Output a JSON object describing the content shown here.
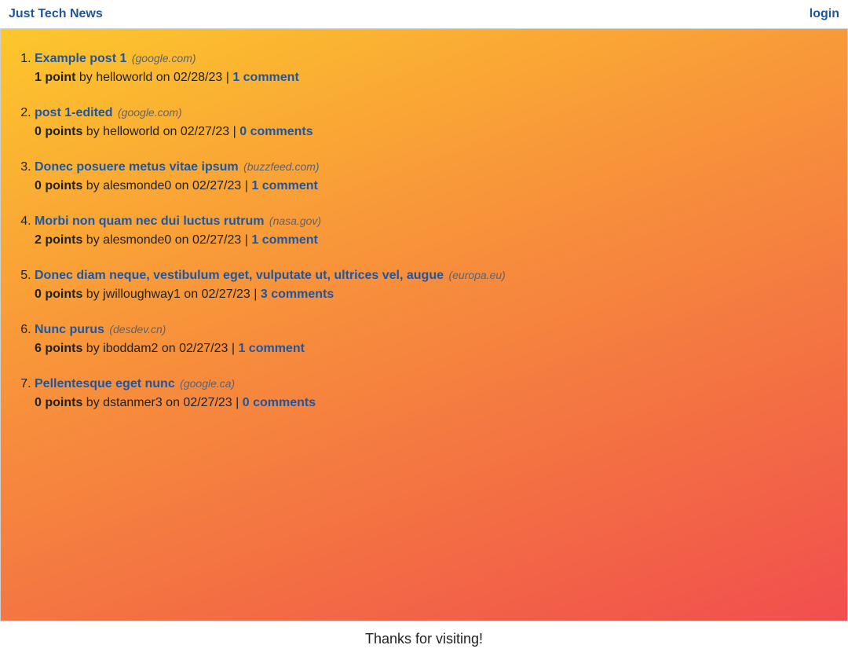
{
  "header": {
    "site_title": "Just Tech News",
    "login_label": "login"
  },
  "posts": [
    {
      "title": "Example post 1",
      "domain": "(google.com)",
      "points": "1 point",
      "by_text": "by helloworld on 02/28/23",
      "separator": "|",
      "comments": "1 comment"
    },
    {
      "title": "post 1-edited",
      "domain": "(google.com)",
      "points": "0 points",
      "by_text": "by helloworld on 02/27/23",
      "separator": "|",
      "comments": "0 comments"
    },
    {
      "title": "Donec posuere metus vitae ipsum",
      "domain": "(buzzfeed.com)",
      "points": "0 points",
      "by_text": "by alesmonde0 on 02/27/23",
      "separator": "|",
      "comments": "1 comment"
    },
    {
      "title": "Morbi non quam nec dui luctus rutrum",
      "domain": "(nasa.gov)",
      "points": "2 points",
      "by_text": "by alesmonde0 on 02/27/23",
      "separator": "|",
      "comments": "1 comment"
    },
    {
      "title": "Donec diam neque, vestibulum eget, vulputate ut, ultrices vel, augue",
      "domain": "(europa.eu)",
      "points": "0 points",
      "by_text": "by jwilloughway1 on 02/27/23",
      "separator": "|",
      "comments": "3 comments"
    },
    {
      "title": "Nunc purus",
      "domain": "(desdev.cn)",
      "points": "6 points",
      "by_text": "by iboddam2 on 02/27/23",
      "separator": "|",
      "comments": "1 comment"
    },
    {
      "title": "Pellentesque eget nunc",
      "domain": "(google.ca)",
      "points": "0 points",
      "by_text": "by dstanmer3 on 02/27/23",
      "separator": "|",
      "comments": "0 comments"
    }
  ],
  "footer": {
    "text": "Thanks for visiting!"
  },
  "colors": {
    "link": "#1e56a0",
    "gradient_top": "#fdc72c",
    "gradient_bottom": "#f24e4e"
  }
}
